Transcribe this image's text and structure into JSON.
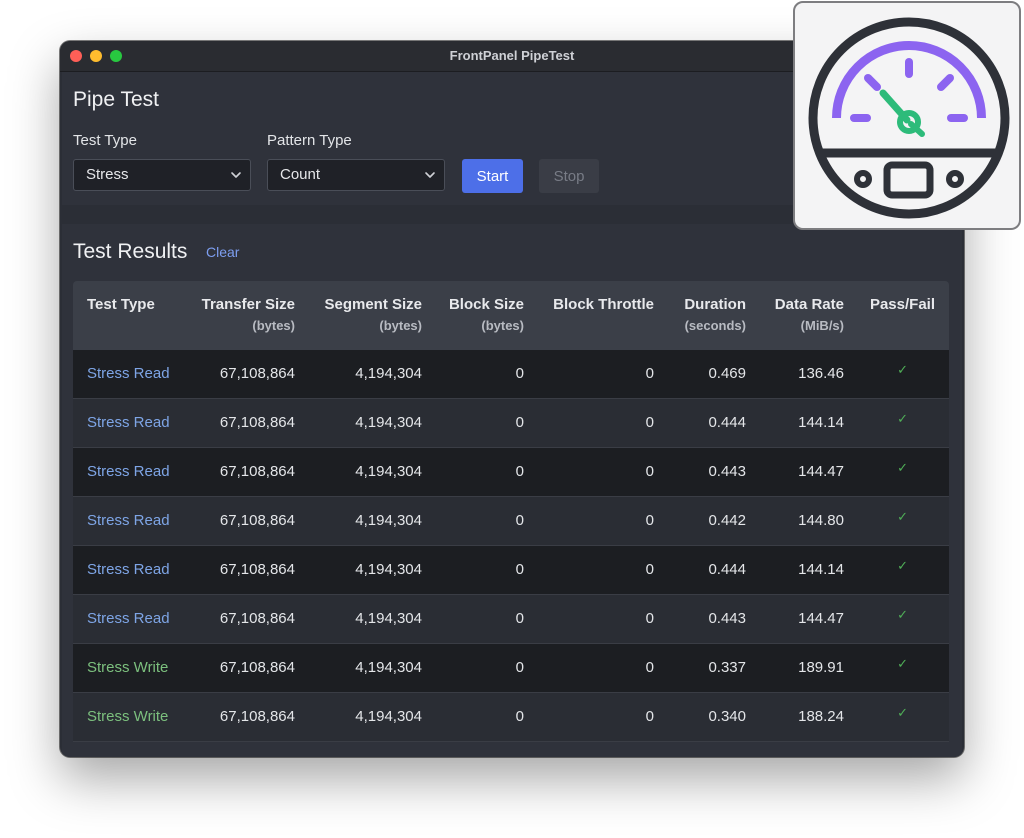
{
  "window": {
    "title": "FrontPanel PipeTest"
  },
  "pipe_test": {
    "heading": "Pipe Test",
    "test_type_label": "Test Type",
    "test_type_value": "Stress",
    "pattern_type_label": "Pattern Type",
    "pattern_type_value": "Count",
    "start_label": "Start",
    "stop_label": "Stop"
  },
  "results": {
    "heading": "Test Results",
    "clear_label": "Clear",
    "columns": [
      {
        "label": "Test Type",
        "unit": ""
      },
      {
        "label": "Transfer Size",
        "unit": "(bytes)"
      },
      {
        "label": "Segment Size",
        "unit": "(bytes)"
      },
      {
        "label": "Block Size",
        "unit": "(bytes)"
      },
      {
        "label": "Block Throttle",
        "unit": ""
      },
      {
        "label": "Duration",
        "unit": "(seconds)"
      },
      {
        "label": "Data Rate",
        "unit": "(MiB/s)"
      },
      {
        "label": "Pass/Fail",
        "unit": ""
      }
    ],
    "rows": [
      {
        "type": "Stress Read",
        "transfer": "67,108,864",
        "segment": "4,194,304",
        "block": "0",
        "throttle": "0",
        "duration": "0.469",
        "rate": "136.46",
        "pass": "✓"
      },
      {
        "type": "Stress Read",
        "transfer": "67,108,864",
        "segment": "4,194,304",
        "block": "0",
        "throttle": "0",
        "duration": "0.444",
        "rate": "144.14",
        "pass": "✓"
      },
      {
        "type": "Stress Read",
        "transfer": "67,108,864",
        "segment": "4,194,304",
        "block": "0",
        "throttle": "0",
        "duration": "0.443",
        "rate": "144.47",
        "pass": "✓"
      },
      {
        "type": "Stress Read",
        "transfer": "67,108,864",
        "segment": "4,194,304",
        "block": "0",
        "throttle": "0",
        "duration": "0.442",
        "rate": "144.80",
        "pass": "✓"
      },
      {
        "type": "Stress Read",
        "transfer": "67,108,864",
        "segment": "4,194,304",
        "block": "0",
        "throttle": "0",
        "duration": "0.444",
        "rate": "144.14",
        "pass": "✓"
      },
      {
        "type": "Stress Read",
        "transfer": "67,108,864",
        "segment": "4,194,304",
        "block": "0",
        "throttle": "0",
        "duration": "0.443",
        "rate": "144.47",
        "pass": "✓"
      },
      {
        "type": "Stress Write",
        "transfer": "67,108,864",
        "segment": "4,194,304",
        "block": "0",
        "throttle": "0",
        "duration": "0.337",
        "rate": "189.91",
        "pass": "✓"
      },
      {
        "type": "Stress Write",
        "transfer": "67,108,864",
        "segment": "4,194,304",
        "block": "0",
        "throttle": "0",
        "duration": "0.340",
        "rate": "188.24",
        "pass": "✓"
      }
    ]
  },
  "colors": {
    "accent": "#4d6fe8",
    "read_link": "#7ea5e6",
    "write_link": "#7cc07e",
    "pass_check": "#4fae57",
    "gauge_purple": "#8c64f0",
    "gauge_needle": "#2dbb7a"
  },
  "icons": {
    "app_icon": "speedometer-icon",
    "select_indicator": "chevron-down-icon"
  }
}
